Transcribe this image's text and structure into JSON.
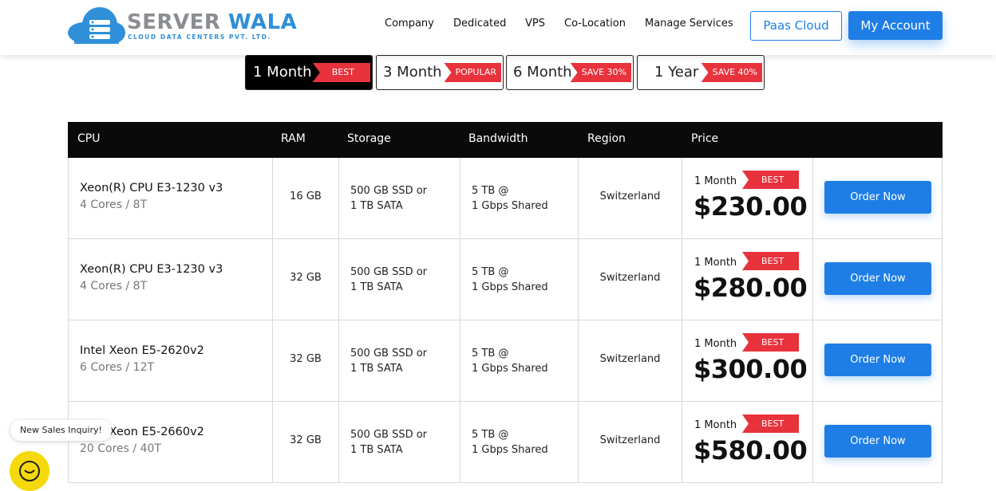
{
  "brand": {
    "name_main": "SERVER",
    "name_accent": "WALA",
    "tagline": "CLOUD DATA CENTERS PVT. LTD."
  },
  "nav": [
    "Company",
    "Dedicated",
    "VPS",
    "Co-Location",
    "Manage Services"
  ],
  "header_buttons": {
    "paas": "Paas Cloud",
    "account": "My Account"
  },
  "tabs": [
    {
      "label": "1 Month",
      "badge": "BEST",
      "active": true
    },
    {
      "label": "3 Month",
      "badge": "POPULAR",
      "active": false
    },
    {
      "label": "6 Month",
      "badge": "SAVE 30%",
      "active": false
    },
    {
      "label": "1 Year",
      "badge": "SAVE 40%",
      "active": false
    }
  ],
  "table": {
    "headers": [
      "CPU",
      "RAM",
      "Storage",
      "Bandwidth",
      "Region",
      "Price"
    ],
    "rows": [
      {
        "cpu": "Xeon(R) CPU E3-1230 v3",
        "cores": "4 Cores / 8T",
        "ram": "16 GB",
        "storage_1": "500 GB SSD or",
        "storage_2": "1 TB SATA",
        "bandwidth_1": "5 TB @",
        "bandwidth_2": "1 Gbps Shared",
        "region": "Switzerland",
        "period": "1 Month",
        "badge": "BEST",
        "price": "$230.00",
        "order": "Order Now"
      },
      {
        "cpu": "Xeon(R) CPU E3-1230 v3",
        "cores": "4 Cores / 8T",
        "ram": "32 GB",
        "storage_1": "500 GB SSD or",
        "storage_2": "1 TB SATA",
        "bandwidth_1": "5 TB @",
        "bandwidth_2": "1 Gbps Shared",
        "region": "Switzerland",
        "period": "1 Month",
        "badge": "BEST",
        "price": "$280.00",
        "order": "Order Now"
      },
      {
        "cpu": "Intel Xeon E5-2620v2",
        "cores": "6 Cores / 12T",
        "ram": "32 GB",
        "storage_1": "500 GB SSD or",
        "storage_2": "1 TB SATA",
        "bandwidth_1": "5 TB @",
        "bandwidth_2": "1 Gbps Shared",
        "region": "Switzerland",
        "period": "1 Month",
        "badge": "BEST",
        "price": "$300.00",
        "order": "Order Now"
      },
      {
        "cpu": "Intel Xeon E5-2660v2",
        "cores": "20 Cores / 40T",
        "ram": "32 GB",
        "storage_1": "500 GB SSD or",
        "storage_2": "1 TB SATA",
        "bandwidth_1": "5 TB @",
        "bandwidth_2": "1 Gbps Shared",
        "region": "Switzerland",
        "period": "1 Month",
        "badge": "BEST",
        "price": "$580.00",
        "order": "Order Now"
      }
    ]
  },
  "inquiry": "New Sales Inquiry!",
  "colors": {
    "accent": "#1e7ee6",
    "badge": "#e8323c",
    "header_dark": "#0a0a0a",
    "chat": "#f5d90a"
  }
}
